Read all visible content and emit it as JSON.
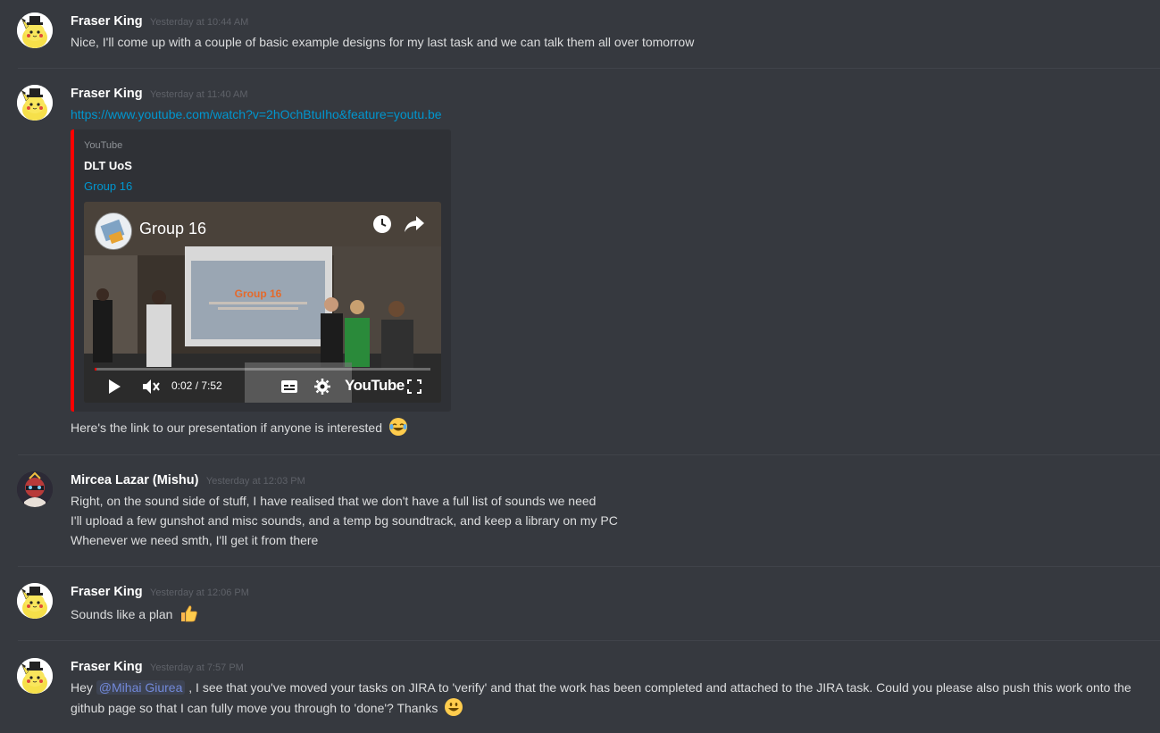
{
  "messages": [
    {
      "username": "Fraser King",
      "timestamp": "Yesterday at 10:44 AM",
      "lines": [
        "Nice, I'll come up with a couple of basic example designs for my last task and we can talk them all over tomorrow"
      ]
    },
    {
      "username": "Fraser King",
      "timestamp": "Yesterday at 11:40 AM",
      "link": "https://www.youtube.com/watch?v=2hOchBtuIho&feature=youtu.be",
      "embed": {
        "provider": "YouTube",
        "title": "DLT UoS",
        "author": "Group 16",
        "video_title": "Group 16",
        "video_time": "0:02 / 7:52",
        "video_brand": "YouTube",
        "progress": 0.004,
        "accent_color": "#ff0000"
      },
      "after_text": "Here's the link to our presentation if anyone is interested",
      "after_emoji": "joy-emoji"
    },
    {
      "username": "Mircea Lazar (Mishu)",
      "timestamp": "Yesterday at 12:03 PM",
      "lines": [
        "Right, on the sound side of stuff, I have realised that we don't have a full list of sounds we need",
        "I'll upload a few gunshot and misc sounds, and a temp bg soundtrack, and keep a library on my PC",
        "Whenever we need smth, I'll get it from there"
      ]
    },
    {
      "username": "Fraser King",
      "timestamp": "Yesterday at 12:06 PM",
      "lines": [
        "Sounds like a plan"
      ],
      "emoji": "thumbsup-emoji"
    },
    {
      "username": "Fraser King",
      "timestamp": "Yesterday at 7:57 PM",
      "line1_prefix": "Hey ",
      "mention": "@Mihai Giurea",
      "line1_suffix": " , I see that you've moved your tasks on JIRA to 'verify' and that the work has been completed and attached to the JIRA task. Could you please also push this work onto the",
      "line2": "github page so that I can fully move you through to 'done'? Thanks",
      "emoji": "smiley-emoji"
    }
  ],
  "colors": {
    "background": "#36393f",
    "link": "#0096cf",
    "mention": "#7289da",
    "youtube_red": "#ff0000"
  }
}
